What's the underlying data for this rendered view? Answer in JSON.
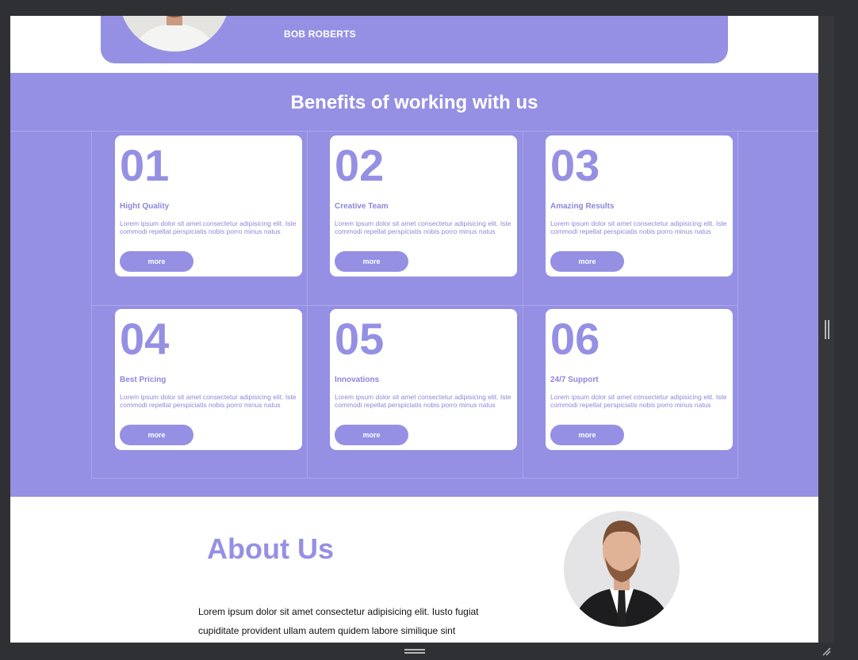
{
  "testimonial": {
    "name": "BOB ROBERTS"
  },
  "benefits": {
    "heading": "Benefits of working with us",
    "cards": [
      {
        "number": "01",
        "title": "Hight Quality",
        "text": "Lorem ipsum dolor sit amet consectetur adipisicing elit. Iste commodi repellat perspiciatis nobis porro minus natus",
        "button": "more"
      },
      {
        "number": "02",
        "title": "Creative Team",
        "text": "Lorem ipsum dolor sit amet consectetur adipisicing elit. Iste commodi repellat perspiciatis nobis porro minus natus",
        "button": "more"
      },
      {
        "number": "03",
        "title": "Amazing Results",
        "text": "Lorem ipsum dolor sit amet consectetur adipisicing elit. Iste commodi repellat perspiciatis nobis porro minus natus",
        "button": "more"
      },
      {
        "number": "04",
        "title": "Best Pricing",
        "text": "Lorem ipsum dolor sit amet consectetur adipisicing elit. Iste commodi repellat perspiciatis nobis porro minus natus",
        "button": "more"
      },
      {
        "number": "05",
        "title": "Innovations",
        "text": "Lorem ipsum dolor sit amet consectetur adipisicing elit. Iste commodi repellat perspiciatis nobis porro minus natus",
        "button": "more"
      },
      {
        "number": "06",
        "title": "24/7 Support",
        "text": "Lorem ipsum dolor sit amet consectetur adipisicing elit. Iste commodi repellat perspiciatis nobis porro minus natus",
        "button": "more"
      }
    ]
  },
  "about": {
    "title": "About Us",
    "text": "Lorem ipsum dolor sit amet consectetur adipisicing elit. Iusto fugiat cupiditate provident ullam autem quidem labore similique sint voluptas, sed recusandae nostrum in dolorum odio rem minima"
  },
  "colors": {
    "accent": "#9590e4",
    "background": "#ffffff",
    "chrome": "#2f3033"
  }
}
